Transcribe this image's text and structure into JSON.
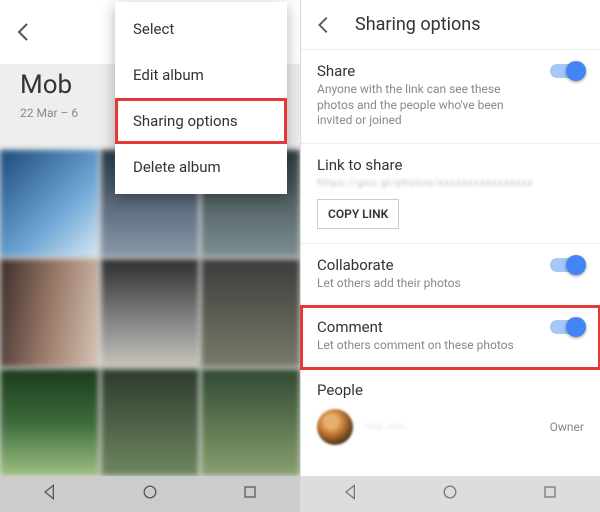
{
  "left": {
    "album_title": "Mob",
    "dates": "22 Mar – 6",
    "menu": {
      "select": "Select",
      "edit": "Edit album",
      "sharing": "Sharing options",
      "delete": "Delete album"
    }
  },
  "right": {
    "header_title": "Sharing options",
    "share": {
      "label": "Share",
      "desc": "Anyone with the link can see these photos and the people who've been invited or joined",
      "on": true
    },
    "link": {
      "label": "Link to share",
      "url_masked": "https://goo.gl/photos/xxxxxxxxxxxxxxxx",
      "copy_label": "COPY LINK"
    },
    "collaborate": {
      "label": "Collaborate",
      "desc": "Let others add their photos",
      "on": true
    },
    "comment": {
      "label": "Comment",
      "desc": "Let others comment on these photos",
      "on": true
    },
    "people": {
      "label": "People",
      "person_name": "—— ——",
      "role": "Owner"
    }
  }
}
